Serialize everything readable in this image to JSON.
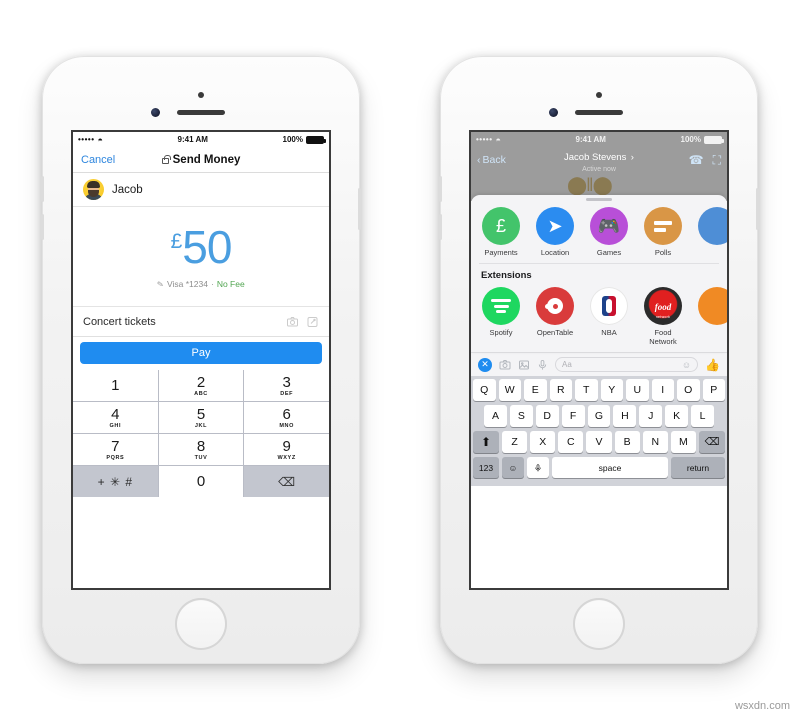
{
  "watermark": "wsxdn.com",
  "left_phone": {
    "status_bar": {
      "signal": "•••••",
      "wifi": "wifi-icon",
      "time": "9:41 AM",
      "battery_pct": "100%"
    },
    "navbar": {
      "cancel": "Cancel",
      "title": "Send Money",
      "lock": "lock-icon"
    },
    "recipient": {
      "name": "Jacob"
    },
    "amount": {
      "currency": "£",
      "value": "50",
      "color": "#4a9ee0"
    },
    "payment_method": {
      "edit": "✎",
      "card": "Visa *1234",
      "separator": "·",
      "fee": "No Fee",
      "fee_color": "#51a551"
    },
    "memo": {
      "text": "Concert tickets",
      "camera": "camera-icon",
      "sticker": "sticker-icon"
    },
    "pay_button": {
      "label": "Pay",
      "color": "#1f8cf0"
    },
    "keypad": [
      {
        "num": "1",
        "sub": ""
      },
      {
        "num": "2",
        "sub": "ABC"
      },
      {
        "num": "3",
        "sub": "DEF"
      },
      {
        "num": "4",
        "sub": "GHI"
      },
      {
        "num": "5",
        "sub": "JKL"
      },
      {
        "num": "6",
        "sub": "MNO"
      },
      {
        "num": "7",
        "sub": "PQRS"
      },
      {
        "num": "8",
        "sub": "TUV"
      },
      {
        "num": "9",
        "sub": "WXYZ"
      },
      {
        "num": "+ ✳ #",
        "sub": ""
      },
      {
        "num": "0",
        "sub": ""
      },
      {
        "num": "⌫",
        "sub": ""
      }
    ]
  },
  "right_phone": {
    "status_bar": {
      "signal": "•••••",
      "wifi": "wifi-icon",
      "time": "9:41 AM",
      "battery_pct": "100%"
    },
    "navbar": {
      "back": "Back",
      "contact_name": "Jacob Stevens",
      "chevron": "›",
      "status": "Active now",
      "call": "phone-icon",
      "video": "video-icon"
    },
    "apps": [
      {
        "label": "Payments",
        "icon": "payments-icon"
      },
      {
        "label": "Location",
        "icon": "location-icon"
      },
      {
        "label": "Games",
        "icon": "games-icon"
      },
      {
        "label": "Polls",
        "icon": "polls-icon"
      },
      {
        "label": "",
        "icon": "more-icon"
      }
    ],
    "extensions_title": "Extensions",
    "extensions": [
      {
        "label": "Spotify",
        "icon": "spotify-icon"
      },
      {
        "label": "OpenTable",
        "icon": "opentable-icon"
      },
      {
        "label": "NBA",
        "icon": "nba-icon"
      },
      {
        "label": "Food Network",
        "icon": "food-network-icon"
      },
      {
        "label": "",
        "icon": "orange-app-icon"
      }
    ],
    "input_bar": {
      "close": "✕",
      "camera": "camera-icon",
      "photos": "photos-icon",
      "mic": "mic-icon",
      "placeholder": "Aa",
      "emoji": "emoji-icon",
      "thumb": "thumbs-up-icon"
    },
    "keyboard": {
      "row1": [
        "Q",
        "W",
        "E",
        "R",
        "T",
        "Y",
        "U",
        "I",
        "O",
        "P"
      ],
      "row2": [
        "A",
        "S",
        "D",
        "F",
        "G",
        "H",
        "J",
        "K",
        "L"
      ],
      "row3": [
        "Z",
        "X",
        "C",
        "V",
        "B",
        "N",
        "M"
      ],
      "shift": "⬆",
      "backspace": "⌫",
      "numbers": "123",
      "emoji": "☺",
      "mic": "mic-icon",
      "space": "space",
      "return": "return"
    }
  }
}
